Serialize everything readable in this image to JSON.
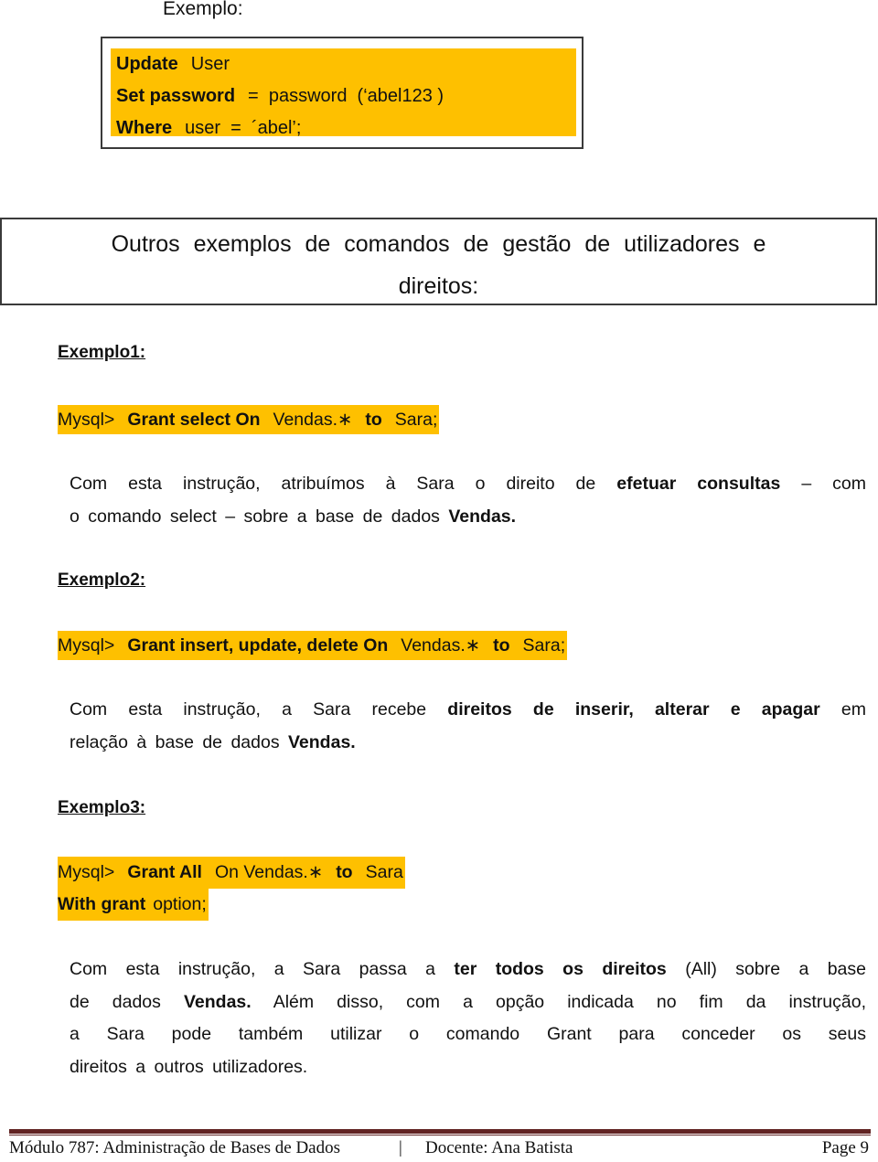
{
  "top_label": "Exemplo:",
  "code_block": {
    "lines": [
      {
        "kw": "Update",
        "rest": "User"
      },
      {
        "kw": "Set password",
        "rest": "=  password  (‘abel123 )"
      },
      {
        "kw": "Where",
        "rest": "user  =  ´abel’;"
      }
    ]
  },
  "section_title": {
    "line1": "Outros exemplos de comandos de gestão de utilizadores e",
    "line2": "direitos:"
  },
  "examples": [
    {
      "heading": "Exemplo1:",
      "command": {
        "prompt": "Mysql>",
        "bold1": "Grant select On",
        "target": "Vendas.∗",
        "bold2": "to",
        "user": "Sara;"
      },
      "description": {
        "l1_a": "Com esta instrução, atribuímos à Sara o direito de",
        "l1_b": "efetuar consultas",
        "l1_c": "– com",
        "l2_a": "o comando select – sobre a base de dados",
        "l2_b": "Vendas."
      }
    },
    {
      "heading": "Exemplo2:",
      "command": {
        "prompt": "Mysql>",
        "bold1": "Grant insert, update, delete On",
        "target": "Vendas.∗",
        "bold2": "to",
        "user": "Sara;"
      },
      "description": {
        "l1_a": "Com esta instrução, a Sara recebe",
        "l1_b": "direitos de inserir, alterar e apagar",
        "l1_c": "em",
        "l2_a": "relação à base de dados",
        "l2_b": "Vendas."
      }
    },
    {
      "heading": "Exemplo3:",
      "command": {
        "prompt": "Mysql>",
        "bold1": "Grant All",
        "target": "On Vendas.∗",
        "bold2": "to",
        "user": "Sara",
        "line2_bold": "With grant",
        "line2_rest": "option;"
      },
      "description": {
        "l1_a": "Com esta instrução, a Sara passa a",
        "l1_b": "ter todos os direitos",
        "l1_c": "(All) sobre a base",
        "l2_a": "de dados",
        "l2_b": "Vendas.",
        "l2_c": "Além disso, com a opção indicada no fim da instrução,",
        "l3": "a Sara pode também utilizar o comando Grant para conceder os seus",
        "l4": "direitos a outros utilizadores."
      }
    }
  ],
  "footer": {
    "module": "Módulo 787: Administração de Bases de Dados",
    "separator": "|",
    "teacher": "Docente: Ana Batista",
    "page": "Page 9"
  },
  "colors": {
    "highlight": "#fec000",
    "footer_rule": "#622423"
  }
}
